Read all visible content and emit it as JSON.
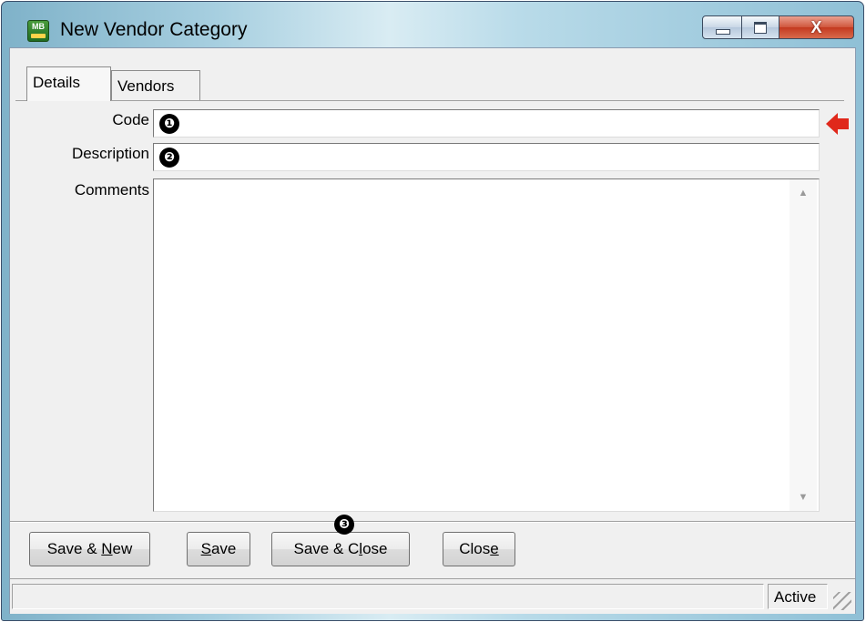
{
  "window": {
    "title": "New Vendor Category",
    "app_icon_text": "MB"
  },
  "titlebar_controls": {
    "close_glyph": "X"
  },
  "tabs": [
    {
      "label": "Details"
    },
    {
      "label": "Vendors"
    }
  ],
  "form": {
    "code_label": "Code",
    "code_value": "",
    "description_label": "Description",
    "description_value": "",
    "comments_label": "Comments",
    "comments_value": ""
  },
  "markers": [
    "❶",
    "❷",
    "❸"
  ],
  "buttons": {
    "save_new_a": "Save & ",
    "save_new_u": "N",
    "save_new_b": "ew",
    "save_u": "S",
    "save_b": "ave",
    "save_close_a": "Save & C",
    "save_close_u": "l",
    "save_close_b": "ose",
    "close_a": "Clos",
    "close_u": "e"
  },
  "status": {
    "state": "Active"
  },
  "colors": {
    "required_arrow": "#e0281b",
    "titlebar_accent": "#a7cfe0"
  }
}
